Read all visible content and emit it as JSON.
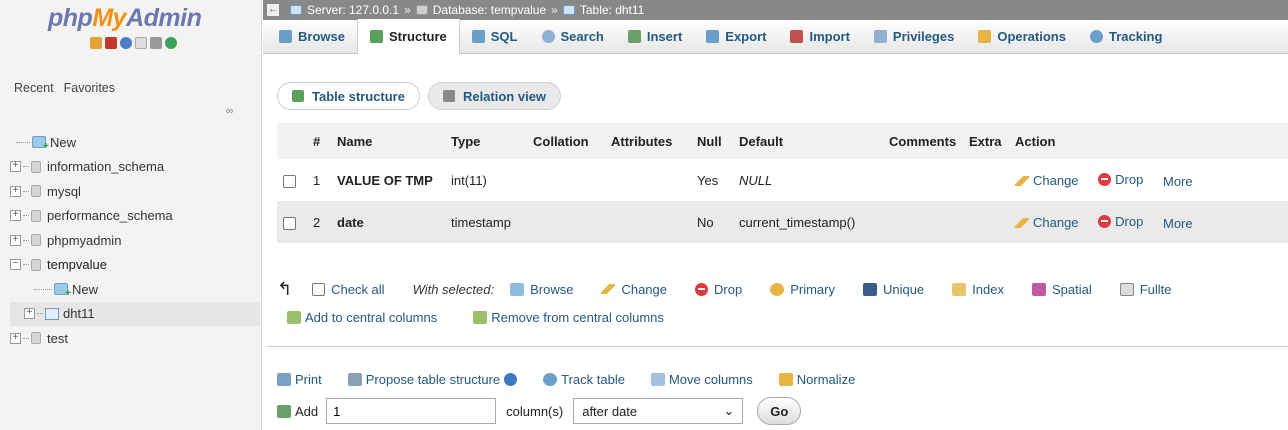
{
  "sidebar": {
    "logo": {
      "part1": "php",
      "part2": "My",
      "part3": "Admin"
    },
    "recent_tab": "Recent",
    "favorites_tab": "Favorites",
    "tree": [
      {
        "label": "New",
        "type": "new"
      },
      {
        "label": "information_schema",
        "type": "db"
      },
      {
        "label": "mysql",
        "type": "db"
      },
      {
        "label": "performance_schema",
        "type": "db"
      },
      {
        "label": "phpmyadmin",
        "type": "db"
      },
      {
        "label": "tempvalue",
        "type": "db",
        "expanded": true
      },
      {
        "label": "New",
        "type": "new",
        "sub": true
      },
      {
        "label": "dht11",
        "type": "table",
        "sub": true
      },
      {
        "label": "test",
        "type": "db"
      }
    ]
  },
  "breadcrumb": {
    "server": "Server: 127.0.0.1",
    "database": "Database: tempvalue",
    "table": "Table: dht11",
    "separator": "»"
  },
  "tabs": [
    {
      "label": "Browse",
      "icon": "browse-icon",
      "color": "#6a9fc9"
    },
    {
      "label": "Structure",
      "icon": "structure-icon",
      "color": "#5aa05a",
      "active": true
    },
    {
      "label": "SQL",
      "icon": "sql-icon",
      "color": "#6a9fc9"
    },
    {
      "label": "Search",
      "icon": "search-icon",
      "color": "#8fb0d0"
    },
    {
      "label": "Insert",
      "icon": "insert-icon",
      "color": "#6aa06a"
    },
    {
      "label": "Export",
      "icon": "export-icon",
      "color": "#6a9fc9"
    },
    {
      "label": "Import",
      "icon": "import-icon",
      "color": "#c05050"
    },
    {
      "label": "Privileges",
      "icon": "privileges-icon",
      "color": "#8fb0d0"
    },
    {
      "label": "Operations",
      "icon": "wrench-icon",
      "color": "#e8b446"
    },
    {
      "label": "Tracking",
      "icon": "eye-icon",
      "color": "#6a9fc9"
    }
  ],
  "subtabs": [
    {
      "label": "Table structure",
      "active": true
    },
    {
      "label": "Relation view"
    }
  ],
  "table": {
    "headers": [
      "#",
      "Name",
      "Type",
      "Collation",
      "Attributes",
      "Null",
      "Default",
      "Comments",
      "Extra",
      "Action"
    ],
    "rows": [
      {
        "num": "1",
        "name": "VALUE OF TMP",
        "type": "int(11)",
        "collation": "",
        "attributes": "",
        "null": "Yes",
        "default": "NULL",
        "comments": "",
        "extra": ""
      },
      {
        "num": "2",
        "name": "date",
        "type": "timestamp",
        "collation": "",
        "attributes": "",
        "null": "No",
        "default": "current_timestamp()",
        "comments": "",
        "extra": ""
      }
    ],
    "actions": {
      "change": "Change",
      "drop": "Drop",
      "more": "More"
    }
  },
  "bulk": {
    "check_all": "Check all",
    "with_selected": "With selected:",
    "browse": "Browse",
    "change": "Change",
    "drop": "Drop",
    "primary": "Primary",
    "unique": "Unique",
    "index": "Index",
    "spatial": "Spatial",
    "fulltext": "Fullte",
    "add_central": "Add to central columns",
    "remove_central": "Remove from central columns"
  },
  "footer": {
    "print": "Print",
    "propose": "Propose table structure",
    "track": "Track table",
    "move": "Move columns",
    "normalize": "Normalize"
  },
  "add_columns": {
    "label": "Add",
    "value": "1",
    "columns_label": "column(s)",
    "position": "after date",
    "go": "Go"
  }
}
